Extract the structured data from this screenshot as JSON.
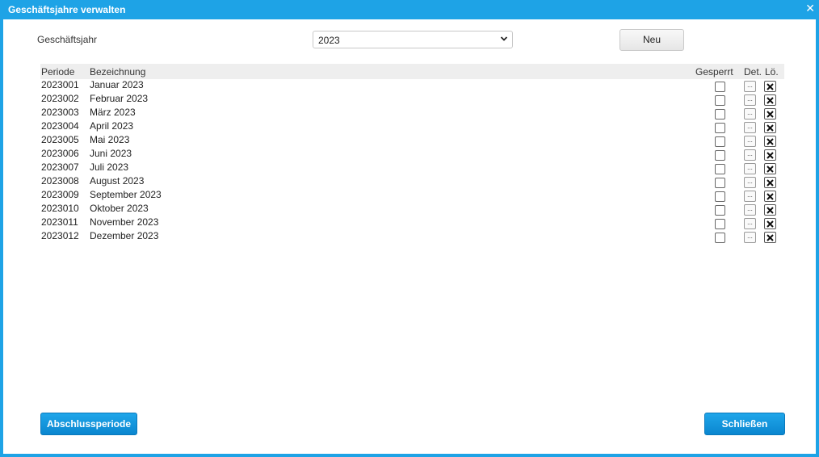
{
  "window": {
    "title": "Geschäftsjahre verwalten",
    "close_glyph": "✕"
  },
  "form": {
    "fiscal_year_label": "Geschäftsjahr",
    "fiscal_year_value": "2023",
    "new_button": "Neu"
  },
  "table": {
    "headers": {
      "periode": "Periode",
      "bezeichnung": "Bezeichnung",
      "gesperrt": "Gesperrt",
      "det": "Det.",
      "loe": "Lö."
    },
    "details_glyph": "...",
    "rows": [
      {
        "periode": "2023001",
        "bezeichnung": "Januar 2023",
        "gesperrt": false
      },
      {
        "periode": "2023002",
        "bezeichnung": "Februar 2023",
        "gesperrt": false
      },
      {
        "periode": "2023003",
        "bezeichnung": "März 2023",
        "gesperrt": false
      },
      {
        "periode": "2023004",
        "bezeichnung": "April 2023",
        "gesperrt": false
      },
      {
        "periode": "2023005",
        "bezeichnung": "Mai 2023",
        "gesperrt": false
      },
      {
        "periode": "2023006",
        "bezeichnung": "Juni 2023",
        "gesperrt": false
      },
      {
        "periode": "2023007",
        "bezeichnung": "Juli 2023",
        "gesperrt": false
      },
      {
        "periode": "2023008",
        "bezeichnung": "August 2023",
        "gesperrt": false
      },
      {
        "periode": "2023009",
        "bezeichnung": "September 2023",
        "gesperrt": false
      },
      {
        "periode": "2023010",
        "bezeichnung": "Oktober 2023",
        "gesperrt": false
      },
      {
        "periode": "2023011",
        "bezeichnung": "November 2023",
        "gesperrt": false
      },
      {
        "periode": "2023012",
        "bezeichnung": "Dezember 2023",
        "gesperrt": false
      }
    ]
  },
  "footer": {
    "closing_period_button": "Abschlussperiode",
    "close_button": "Schließen"
  },
  "colors": {
    "accent": "#1ea3e6",
    "header_bg": "#eeeeee"
  },
  "icons": {
    "close": "close-icon",
    "dropdown": "chevron-down-icon",
    "delete": "delete-x-icon",
    "details": "ellipsis-icon"
  }
}
